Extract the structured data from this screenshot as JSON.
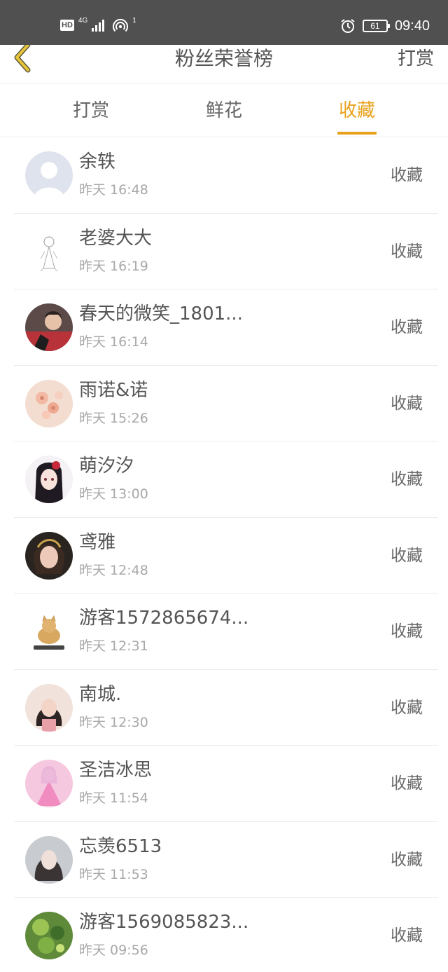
{
  "status_bar": {
    "hd": "HD",
    "network": "4G",
    "hotspot_count": "1",
    "battery": "61",
    "time": "09:40"
  },
  "header": {
    "title": "粉丝荣誉榜",
    "action_label": "打赏"
  },
  "tabs": [
    {
      "label": "打赏",
      "active": false
    },
    {
      "label": "鲜花",
      "active": false
    },
    {
      "label": "收藏",
      "active": true
    }
  ],
  "accent_color": "#e8a21d",
  "list": [
    {
      "name": "余轶",
      "time": "昨天 16:48",
      "action": "收藏",
      "avatar": "default-avatar-icon"
    },
    {
      "name": "老婆大大",
      "time": "昨天 16:19",
      "action": "收藏",
      "avatar": "sketch-avatar"
    },
    {
      "name": "春天的微笑_1801...",
      "time": "昨天 16:14",
      "action": "收藏",
      "avatar": "photo-avatar"
    },
    {
      "name": "雨诺&诺",
      "time": "昨天 15:26",
      "action": "收藏",
      "avatar": "flower-avatar"
    },
    {
      "name": "萌汐汐",
      "time": "昨天 13:00",
      "action": "收藏",
      "avatar": "anime-avatar"
    },
    {
      "name": "鸢雅",
      "time": "昨天 12:48",
      "action": "收藏",
      "avatar": "photo-avatar"
    },
    {
      "name": "游客1572865674...",
      "time": "昨天 12:31",
      "action": "收藏",
      "avatar": "cat-avatar"
    },
    {
      "name": "南城.",
      "time": "昨天 12:30",
      "action": "收藏",
      "avatar": "photo-avatar"
    },
    {
      "name": "圣洁冰思",
      "time": "昨天 11:54",
      "action": "收藏",
      "avatar": "pink-dress-avatar"
    },
    {
      "name": "忘羡6513",
      "time": "昨天 11:53",
      "action": "收藏",
      "avatar": "photo-avatar"
    },
    {
      "name": "游客1569085823...",
      "time": "昨天 09:56",
      "action": "收藏",
      "avatar": "green-art-avatar"
    }
  ]
}
